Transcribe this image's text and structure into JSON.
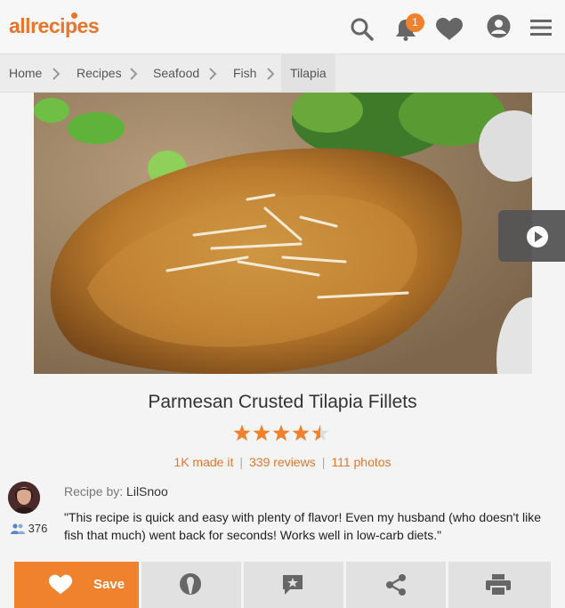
{
  "header": {
    "logo_text": "allrecipes",
    "notification_count": "1",
    "icons": [
      "search-icon",
      "bell-icon",
      "heart-icon",
      "profile-icon",
      "menu-icon"
    ],
    "accent_color": "#f0812d"
  },
  "breadcrumb": {
    "items": [
      "Home",
      "Recipes",
      "Seafood",
      "Fish",
      "Tilapia"
    ]
  },
  "recipe": {
    "title": "Parmesan Crusted Tilapia Fillets",
    "rating": 4.5,
    "rating_max": 5,
    "made_it": "1K made it",
    "reviews": "339 reviews",
    "photos": "111 photos",
    "author_prefix": "Recipe by:",
    "author": "LilSnoo",
    "followers": "376",
    "description": "\"This recipe is quick and easy with plenty of flavor! Even my husband (who doesn't like fish that much) went back for seconds! Works well in low-carb diets.\""
  },
  "actions": {
    "save_label": "Save",
    "icons": [
      "heart-icon",
      "made-it-icon",
      "review-icon",
      "share-icon",
      "print-icon"
    ]
  }
}
